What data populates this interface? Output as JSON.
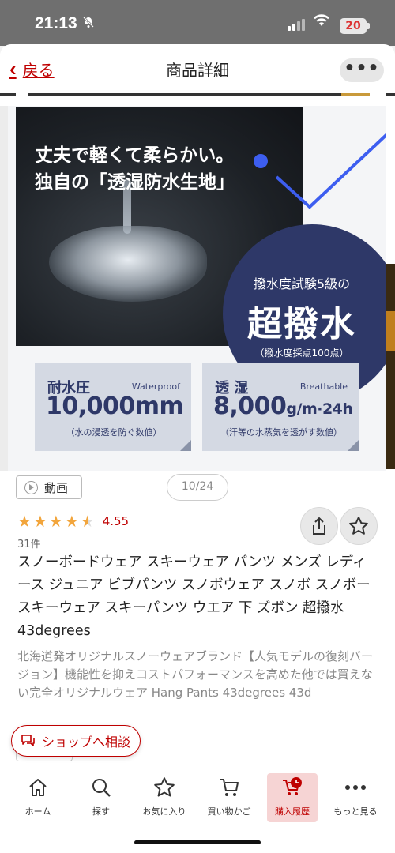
{
  "status_bar": {
    "time": "21:13",
    "battery": "20"
  },
  "header": {
    "back_label": "戻る",
    "title": "商品詳細",
    "more_label": "•••"
  },
  "slide": {
    "headline_line1": "丈夫で軽くて柔らかい。",
    "headline_line2": "独自の「透湿防水生地」",
    "badge_top": "撥水度試験5級の",
    "badge_main": "超撥水",
    "badge_note": "（撥水度採点100点）",
    "spec_water": {
      "label": "耐水圧",
      "en": "Waterproof",
      "value": "10,000mm",
      "note": "（水の浸透を防ぐ数値）"
    },
    "spec_breath": {
      "label": "透 湿",
      "en": "Breathable",
      "value": "8,000",
      "unit": "g/m·24h",
      "note": "（汗等の水蒸気を透がす数値）"
    },
    "accent_color": "#2e3868"
  },
  "media": {
    "video_label": "動画",
    "counter": "10/24"
  },
  "rating": {
    "score": "4.55",
    "value": 4.55,
    "max": 5,
    "reviews": "31件"
  },
  "product": {
    "title": "スノーボードウェア スキーウェア パンツ メンズ レディース ジュニア ビブパンツ スノボウェア スノボ スノボー スキーウェア スキーパンツ ウエア 下 ズボン 超撥水 43degrees",
    "description": "北海道発オリジナルスノーウェアブランド【人気モデルの復刻バージョン】機能性を抑えコストパフォーマンスを高めた他では買えない完全オリジナルウェア Hang Pants 43degrees 43d"
  },
  "consult_button": "ショップへ相談",
  "bottom_nav": [
    {
      "label": "ホーム",
      "icon": "home-icon"
    },
    {
      "label": "探す",
      "icon": "search-icon"
    },
    {
      "label": "お気に入り",
      "icon": "star-icon"
    },
    {
      "label": "買い物かご",
      "icon": "cart-icon"
    },
    {
      "label": "購入履歴",
      "icon": "purchase-history-icon",
      "active": true
    },
    {
      "label": "もっと見る",
      "icon": "more-icon"
    }
  ],
  "colors": {
    "brand": "#bf0000",
    "star": "#f2a53c"
  }
}
